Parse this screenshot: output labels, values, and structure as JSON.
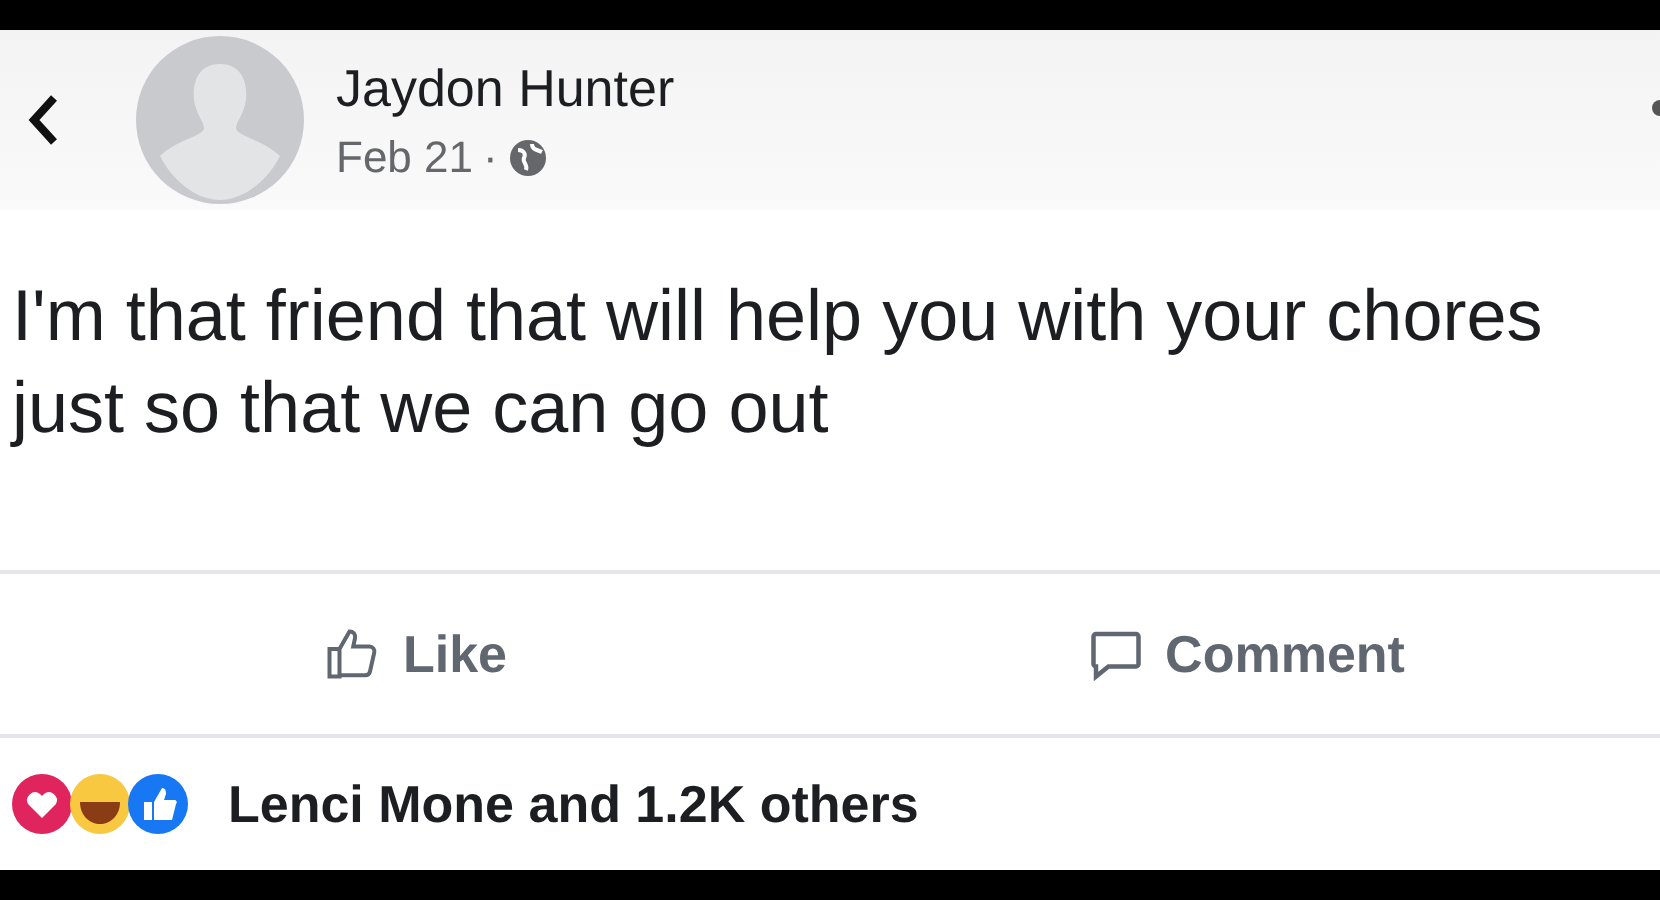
{
  "post": {
    "author": "Jaydon Hunter",
    "date": "Feb 21",
    "separator": "·",
    "text": "I'm that friend that will help you with your chores just so that we can go out"
  },
  "actions": [
    {
      "kind": "like",
      "label": "Like"
    },
    {
      "kind": "comment",
      "label": "Comment"
    }
  ],
  "reactions": {
    "summary": "Lenci Mone and 1.2K others"
  }
}
